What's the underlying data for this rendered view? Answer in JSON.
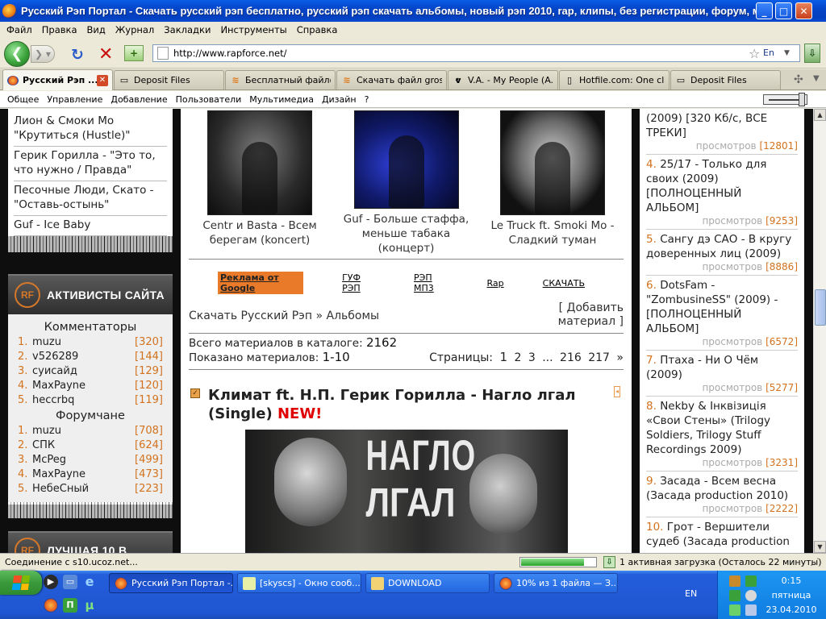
{
  "window": {
    "title": "Русский Рэп Портал - Скачать русский рэп бесплатно, русский рэп скачать альбомы, новый рэп 2010, rap, клипы, без регистрации, форум, музыка, с...",
    "min": "_",
    "max": "□",
    "close": "✕"
  },
  "menu": [
    "Файл",
    "Правка",
    "Вид",
    "Журнал",
    "Закладки",
    "Инструменты",
    "Справка"
  ],
  "nav": {
    "url": "http://www.rapforce.net/",
    "lang": "En"
  },
  "tabs": [
    {
      "label": "Русский Рэп ...",
      "icon": "firefox-icon"
    },
    {
      "label": "Deposit Files",
      "icon": "depositfiles-icon"
    },
    {
      "label": "Бесплатный файло...",
      "icon": "letitbit-icon"
    },
    {
      "label": "Скачать файл gros...",
      "icon": "letitbit-icon"
    },
    {
      "label": "V.A. - My People (A...",
      "icon": "rap-icon"
    },
    {
      "label": "Hotfile.com: One cli...",
      "icon": "page-icon"
    },
    {
      "label": "Deposit Files",
      "icon": "depositfiles-icon"
    }
  ],
  "admin_menu": [
    "Общее",
    "Управление",
    "Добавление",
    "Пользователи",
    "Мультимедиа",
    "Дизайн",
    "?"
  ],
  "left": {
    "top_items": [
      "Лион & Смоки Мо \"Крутиться (Hustle)\"",
      "Герик Горилла - \"Это то, что нужно / Правда\"",
      "Песочные Люди, Скато - \"Оставь-остынь\"",
      "Guf - Ice Baby"
    ],
    "block1_title": "АКТИВИСТЫ САЙТА",
    "logo": "RF",
    "commenters_title": "Комментаторы",
    "commenters": [
      {
        "n": "1.",
        "name": "muzu",
        "v": "[320]"
      },
      {
        "n": "2.",
        "name": "v526289",
        "v": "[144]"
      },
      {
        "n": "3.",
        "name": "суисайд",
        "v": "[129]"
      },
      {
        "n": "4.",
        "name": "MaxPayne",
        "v": "[120]"
      },
      {
        "n": "5.",
        "name": "heccrbq",
        "v": "[119]"
      }
    ],
    "forum_title": "Форумчане",
    "forum": [
      {
        "n": "1.",
        "name": "muzu",
        "v": "[708]"
      },
      {
        "n": "2.",
        "name": "СПК",
        "v": "[624]"
      },
      {
        "n": "3.",
        "name": "McPeg",
        "v": "[499]"
      },
      {
        "n": "4.",
        "name": "MaxPayne",
        "v": "[473]"
      },
      {
        "n": "5.",
        "name": "НебеСный",
        "v": "[223]"
      }
    ],
    "block2_title": "ЛУЧШАЯ 10 В"
  },
  "main": {
    "thumbs": [
      "Centr и Basta - Всем берегам (koncert)",
      "Guf - Больше стаффа, меньше табака (концерт)",
      "Le Truck ft. Smoki Mo - Сладкий туман"
    ],
    "ads": [
      "Реклама от Google",
      "ГУФ РЭП",
      "РЭП МП3",
      "Rap",
      "СКАЧАТЬ"
    ],
    "breadcrumb": "Скачать Русский Рэп » Альбомы",
    "add_material": "[ Добавить материал ]",
    "total_label": "Всего материалов в каталоге:",
    "total_value": "2162",
    "shown_label": "Показано материалов:",
    "shown_value": "1-10",
    "pages_label": "Страницы:",
    "pages": [
      "1",
      "2",
      "3",
      "...",
      "216",
      "217",
      "»"
    ],
    "post_title": "Климат ft. Н.П. Герик Горилла - Нагло лгал (Single)",
    "post_new": "NEW!",
    "cover_text1": "НАГЛО",
    "cover_text2": "ЛГАЛ"
  },
  "right": {
    "items": [
      {
        "num": "",
        "title": "(2009) [320 Кб/с, ВСЕ ТРЕКИ]",
        "views": "[12801]"
      },
      {
        "num": "4.",
        "title": "25/17 - Только для своих (2009) [ПОЛНОЦЕННЫЙ АЛЬБОМ]",
        "views": "[9253]"
      },
      {
        "num": "5.",
        "title": "Сангу дэ САО - В кругу доверенных лиц (2009)",
        "views": "[8886]"
      },
      {
        "num": "6.",
        "title": "DotsFam - \"ZombusineSS\" (2009) - [ПОЛНОЦЕННЫЙ АЛЬБОМ]",
        "views": "[6572]"
      },
      {
        "num": "7.",
        "title": "Птаха - Ни О Чём (2009)",
        "views": "[5277]"
      },
      {
        "num": "8.",
        "title": "Nekby & Інквізиція «Свои Стены» (Trilogy Soldiers, Trilogy Stuff Recordings 2009)",
        "views": "[3231]"
      },
      {
        "num": "9.",
        "title": "Засада - Всем весна (Засада production 2010)",
        "views": "[2222]"
      },
      {
        "num": "10.",
        "title": "Грот - Вершители судеб (Засада production",
        "views": ""
      }
    ],
    "views_label": "просмотров"
  },
  "status": {
    "text": "Соединение с s10.ucoz.net...",
    "download": "1 активная загрузка (Осталось 22 минуты)",
    "progress": 0.85
  },
  "taskbar": {
    "start": "пуск",
    "buttons": [
      {
        "label": "Русский Рэп Портал -...",
        "active": true
      },
      {
        "label": "[skyscs] - Окно сооб...",
        "active": false
      },
      {
        "label": "DOWNLOAD",
        "active": false
      },
      {
        "label": "10% из 1 файла — З...",
        "active": false
      }
    ],
    "lang": "EN",
    "time": "0:15",
    "day": "пятница",
    "date": "23.04.2010"
  },
  "colors": {
    "accent": "#d2721e",
    "new": "#e00000",
    "xp_blue": "#245edb",
    "start_green": "#3a9a3a"
  }
}
